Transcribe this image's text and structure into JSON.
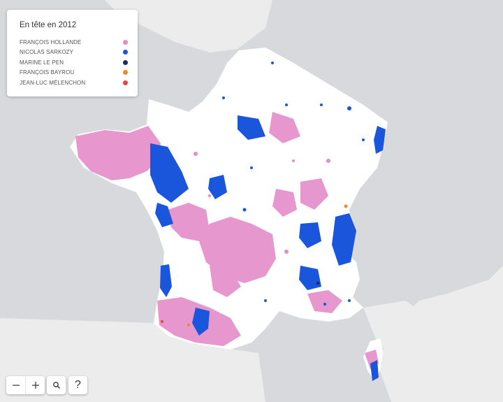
{
  "legend": {
    "title": "En tête en 2012",
    "items": [
      {
        "label": "FRANÇOIS HOLLANDE",
        "color": "#e48cc8"
      },
      {
        "label": "NICOLAS SARKOZY",
        "color": "#1a56db"
      },
      {
        "label": "MARINE LE PEN",
        "color": "#1b2b5a"
      },
      {
        "label": "FRANÇOIS BAYROU",
        "color": "#f08a24"
      },
      {
        "label": "JEAN-LUC MÉLENCHON",
        "color": "#e2463d"
      }
    ]
  },
  "controls": {
    "zoom_out_icon": "minus-icon",
    "zoom_in_icon": "plus-icon",
    "search_icon": "magnifier-icon",
    "help_label": "?"
  },
  "map": {
    "land_color": "#ffffff",
    "sea_color": "#d7d9dc",
    "neighbor_color": "#ececec"
  }
}
